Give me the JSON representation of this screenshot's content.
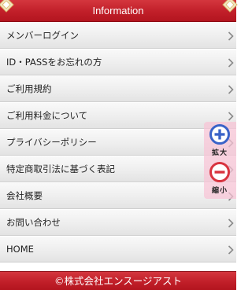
{
  "header": {
    "title": "Information"
  },
  "menu": {
    "items": [
      {
        "label": "メンバーログイン"
      },
      {
        "label": "ID・PASSをお忘れの方"
      },
      {
        "label": "ご利用規約"
      },
      {
        "label": "ご利用料金について"
      },
      {
        "label": "プライバシーポリシー"
      },
      {
        "label": "特定商取引法に基づく表記"
      },
      {
        "label": "会社概要"
      },
      {
        "label": "お問い合わせ"
      },
      {
        "label": "HOME"
      }
    ]
  },
  "zoom": {
    "in_label": "拡大",
    "out_label": "縮小",
    "in_icon": "zoom-in-icon",
    "out_icon": "zoom-out-icon"
  },
  "footer": {
    "copyright": "©株式会社エンスージアスト"
  },
  "colors": {
    "header_red": "#c11f29",
    "zoom_blue": "#3a63c8",
    "zoom_red": "#d8333f",
    "zoom_panel_pink": "#f8c4d6"
  }
}
